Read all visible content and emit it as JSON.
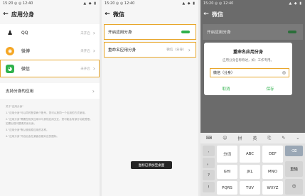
{
  "status": {
    "time": "15:20 ◎ ◎ 12:40",
    "right": "▲ ◆ ▮"
  },
  "screen1": {
    "title": "应用分身",
    "apps": [
      {
        "name": "QQ",
        "status": "未开启"
      },
      {
        "name": "微博",
        "status": "未开启"
      },
      {
        "name": "微信",
        "status": "未开启"
      }
    ],
    "support": "支持分身的应用",
    "notes": [
      "关于\"应用分身\"",
      "1.\"应用分身\"可以同时登录两个账号，您可以按同一个应用的方式使用。",
      "2.\"应用分身\"需要在相关应用中与其他应用交互，您可能会有部分功能受限，如果出现问题请关闭分身。",
      "3.\"应用分身\"默认使用原应用的名称。",
      "4.\"应用分身\"开启后会在桌面创建对应的图标。"
    ]
  },
  "screen2": {
    "title": "微信",
    "enable_label": "开启应用分身",
    "rename_label": "重命名应用分身",
    "rename_value": "微信（分身）",
    "toast": "图标已添加至桌面"
  },
  "screen3": {
    "title": "微信",
    "enable_label": "开启应用分身",
    "dialog_title": "重命名应用分身",
    "dialog_desc": "应用分身名称称述，如：工作专用。",
    "field_value": "微信（分身）",
    "cancel": "取消",
    "save": "保存",
    "kb_toolbar": [
      "⌨",
      "☺",
      "拼",
      "英",
      "⎘",
      "✎",
      "⌄"
    ],
    "keys": {
      "row_side": [
        ",",
        "。",
        "?",
        "!"
      ],
      "row1": [
        "分词",
        "ABC",
        "DEF"
      ],
      "row2": [
        "GHI",
        "JKL",
        "MNO"
      ],
      "row3": [
        "PQRS",
        "TUV",
        "WXYZ"
      ],
      "delete": "⌫",
      "reset": "重输",
      "smile": "☺"
    }
  },
  "colors": {
    "accent": "#e8a62a",
    "green": "#2fb24c"
  }
}
